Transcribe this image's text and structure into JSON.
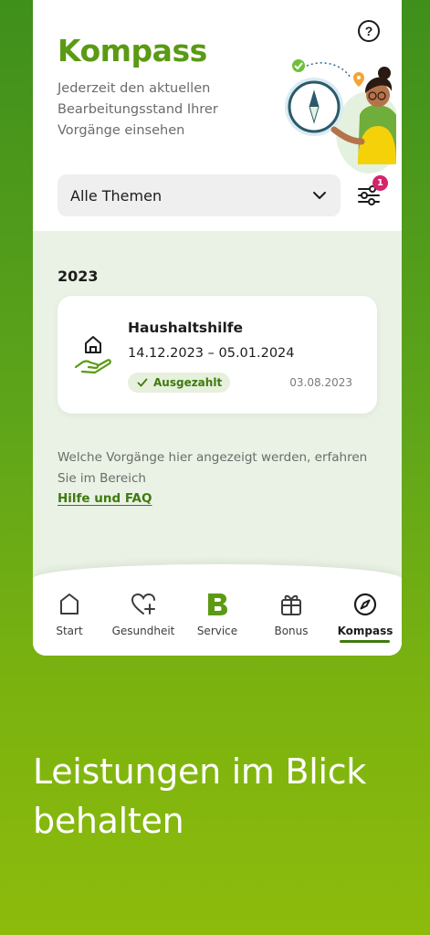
{
  "header": {
    "title": "Kompass",
    "subtitle": "Jederzeit den aktuellen Bearbeitungsstand Ihrer Vorgänge einsehen",
    "help_icon": "question-circle-icon",
    "help_glyph": "?"
  },
  "filter": {
    "dropdown_value": "Alle Themen",
    "badge_count": "1"
  },
  "timeline": {
    "year": "2023",
    "items": [
      {
        "title": "Haushaltshilfe",
        "dates": "14.12.2023 – 05.01.2024",
        "status": "Ausgezahlt",
        "date": "03.08.2023",
        "icon": "house-hand-icon"
      }
    ]
  },
  "info": {
    "text": "Welche Vorgänge hier angezeigt werden, erfahren Sie im Bereich",
    "link": "Hilfe und FAQ"
  },
  "tabs": [
    {
      "label": "Start",
      "icon": "home-icon"
    },
    {
      "label": "Gesundheit",
      "icon": "heart-plus-icon"
    },
    {
      "label": "Service",
      "icon": "b-logo-icon"
    },
    {
      "label": "Bonus",
      "icon": "gift-icon"
    },
    {
      "label": "Kompass",
      "icon": "compass-icon",
      "active": true
    }
  ],
  "promo": {
    "headline": "Leistungen im Blick behalten"
  },
  "colors": {
    "brand_green": "#5a9a14",
    "dark_green": "#3f7a10",
    "badge_pink": "#d5246b",
    "content_bg": "#e9f2e4"
  }
}
